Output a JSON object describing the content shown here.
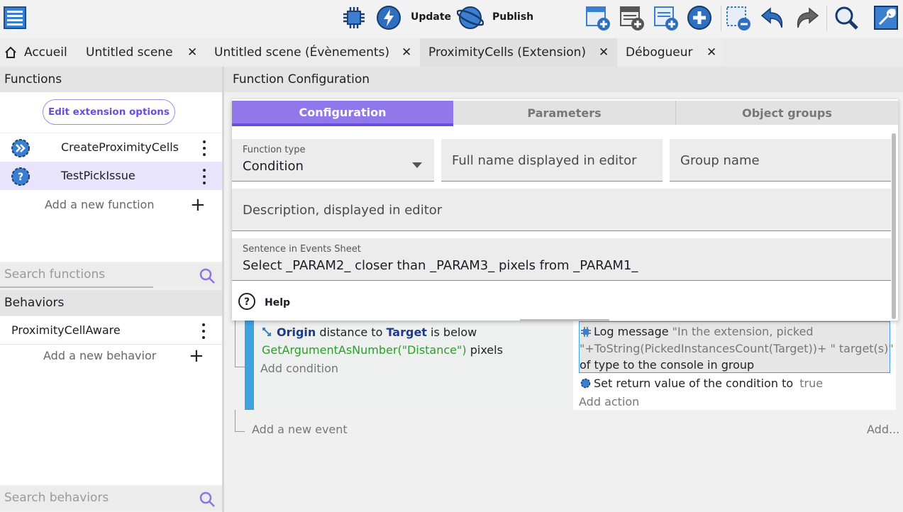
{
  "toolbar": {
    "update_label": "Update",
    "publish_label": "Publish",
    "icons": [
      "project-manager-icon",
      "debug-icon",
      "update-icon",
      "publish-icon",
      "add-event-icon",
      "add-sub-event-icon",
      "add-comment-icon",
      "add-generic-icon",
      "delete-icon",
      "undo-icon",
      "redo-icon",
      "search-icon",
      "settings-icon"
    ]
  },
  "tabs": [
    {
      "label": "Accueil",
      "closable": false
    },
    {
      "label": "Untitled scene",
      "closable": true
    },
    {
      "label": "Untitled scene (Évènements)",
      "closable": true
    },
    {
      "label": "ProximityCells (Extension)",
      "closable": true,
      "active": true
    },
    {
      "label": "Débogueur",
      "closable": true
    }
  ],
  "tab_close_glyph": "✕",
  "functions_panel": {
    "title": "Functions",
    "edit_button": "Edit extension options",
    "items": [
      {
        "label": "CreateProximityCells",
        "icon": "action-function-icon"
      },
      {
        "label": "TestPickIssue",
        "icon": "condition-function-icon",
        "selected": true
      }
    ],
    "add_label": "Add a new function",
    "search_placeholder": "Search functions"
  },
  "behaviors_panel": {
    "title": "Behaviors",
    "items": [
      {
        "label": "ProximityCellAware"
      }
    ],
    "add_label": "Add a new behavior",
    "search_placeholder": "Search behaviors"
  },
  "config": {
    "header": "Function Configuration",
    "tabs": [
      "Configuration",
      "Parameters",
      "Object groups"
    ],
    "active_tab": "Configuration",
    "function_type_label": "Function type",
    "function_type_value": "Condition",
    "full_name_placeholder": "Full name displayed in editor",
    "group_name_placeholder": "Group name",
    "description_placeholder": "Description, displayed in editor",
    "sentence_label": "Sentence in Events Sheet",
    "sentence_value": "Select _PARAM2_ closer than _PARAM3_ pixels from _PARAM1_",
    "help_label": "Help"
  },
  "events": {
    "condition_obj1": "Origin",
    "condition_mid": "distance to",
    "condition_obj2": "Target",
    "condition_tail": "is below",
    "condition_expr": "GetArgumentAsNumber(\"Distance\")",
    "condition_unit": "pixels",
    "add_condition": "Add condition",
    "action1_prefix": "Log message",
    "action1_line1": "\"In the extension, picked",
    "action1_line2": "\"+ToString(PickedInstancesCount(Target))+ \" target(s)\"",
    "action1_line3": "of type  to the console in group",
    "action2_text": "Set return value of the condition to",
    "action2_value": "true",
    "add_action": "Add action",
    "add_event": "Add a new event",
    "add_more": "Add..."
  },
  "colors": {
    "accent": "#9077ea",
    "accent_dark": "#6a4ce0",
    "event_bar": "#3fa1e0",
    "selected_row": "#e8e4fb"
  }
}
